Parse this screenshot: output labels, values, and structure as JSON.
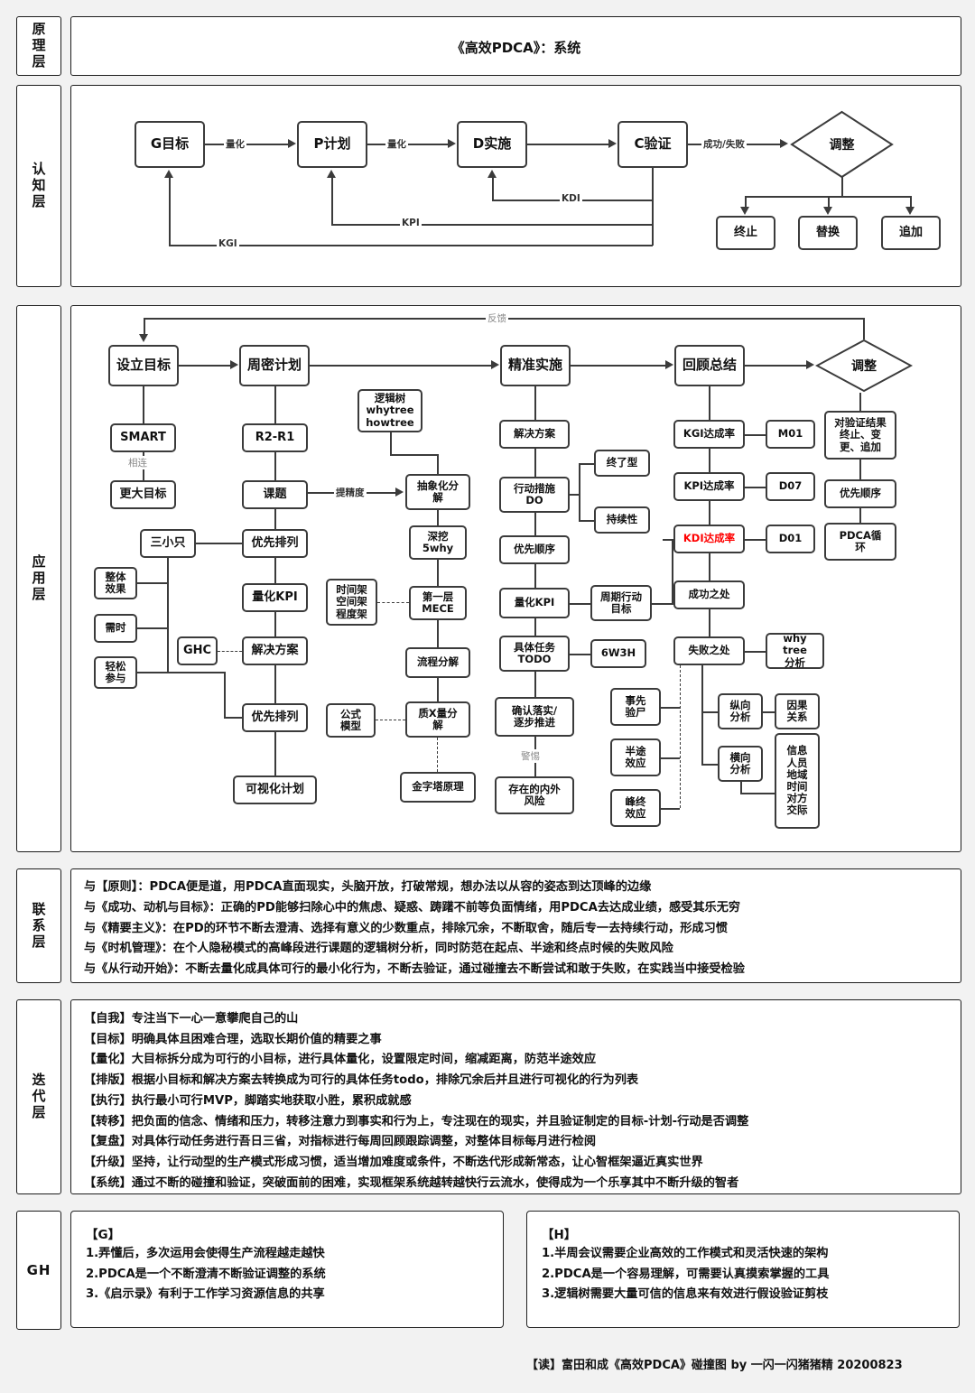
{
  "layers": {
    "principle": "原理层",
    "cognition": "认知层",
    "application": "应用层",
    "connection": "联系层",
    "iteration": "迭代层",
    "gh": "GH"
  },
  "title": "《高效PDCA》：系统",
  "cognition": {
    "nodes": {
      "g": "G目标",
      "p": "P计划",
      "d": "D实施",
      "c": "C验证",
      "adjust": "调整",
      "stop": "终止",
      "replace": "替换",
      "append": "追加"
    },
    "edges": {
      "quant1": "量化",
      "quant2": "量化",
      "succfail": "成功/失败",
      "kdi": "KDI",
      "kpi": "KPI",
      "kgi": "KGI"
    }
  },
  "application": {
    "feedback": "反馈",
    "main": {
      "goal": "设立目标",
      "plan": "周密计划",
      "do": "精准实施",
      "review": "回顾总结",
      "adjust": "调整"
    },
    "goal_col": {
      "smart": "SMART",
      "link_label": "相连",
      "bigger": "更大目标"
    },
    "plan_col": {
      "r2r1": "R2-R1",
      "topic": "课题",
      "prior1": "优先排列",
      "kpi": "量化KPI",
      "solution": "解决方案",
      "prior2": "优先排列",
      "visual": "可视化计划",
      "ghc": "GHC",
      "three": "三小只",
      "whole": "整体\n效果",
      "need": "需时",
      "easy": "轻松\n参与",
      "precision_label": "提精度"
    },
    "decomp_col": {
      "logic_tree": "逻辑树\nwhytree\nhowtree",
      "abstract": "抽象化分\n解",
      "fivewhy": "深挖\n5why",
      "mece": "第一层\nMECE",
      "frames": "时间架\n空间架\n程度架",
      "process": "流程分解",
      "formula": "公式\n模型",
      "qxq": "质X量分\n解",
      "pyramid": "金字塔原理"
    },
    "do_col": {
      "solution": "解决方案",
      "action": "行动措施\nDO",
      "ending": "终了型",
      "lasting": "持续性",
      "priority": "优先顺序",
      "kpi": "量化KPI",
      "cycle_goal": "周期行动\n目标",
      "todo": "具体任务\nTODO",
      "w6h3": "6W3H",
      "confirm": "确认落实/\n逐步推进",
      "alert_label": "警惕",
      "risk": "存在的内外\n风险",
      "pre_autopsy": "事先\n验尸",
      "midway": "半途\n效应",
      "peakend": "峰终\n效应"
    },
    "review_col": {
      "kgi": "KGI达成率",
      "kgi_code": "M01",
      "kpi": "KPI达成率",
      "kpi_code": "D07",
      "kdi": "KDI达成率",
      "kdi_code": "D01",
      "success": "成功之处",
      "failure": "失败之处",
      "whytree": "why tree\n分析",
      "vertical": "纵向\n分析",
      "causal": "因果\n关系",
      "horizontal": "横向\n分析",
      "dims": "信息\n人员\n地域\n时间\n对方\n交际"
    },
    "adjust_col": {
      "result": "对验证结果\n终止、变\n更、追加",
      "priority": "优先顺序",
      "pdca": "PDCA循\n环"
    }
  },
  "connection_lines": [
    "与【原则】：PDCA便是道，用PDCA直面现实，头脑开放，打破常规，想办法以从容的姿态到达顶峰的边缘",
    "与《成功、动机与目标》：正确的PD能够扫除心中的焦虑、疑惑、踌躇不前等负面情绪，用PDCA去达成业绩，感受其乐无穷",
    "与《精要主义》：在PD的环节不断去澄清、选择有意义的少数重点，排除冗余，不断取舍，随后专一去持续行动，形成习惯",
    "与《时机管理》：在个人隐秘模式的高峰段进行课题的逻辑树分析，同时防范在起点、半途和终点时候的失败风险",
    "与《从行动开始》：不断去量化成具体可行的最小化行为，不断去验证，通过碰撞去不断尝试和敢于失败，在实践当中接受检验"
  ],
  "iteration_lines": [
    "【自我】专注当下一心一意攀爬自己的山",
    "【目标】明确具体且困难合理，选取长期价值的精要之事",
    "【量化】大目标拆分成为可行的小目标，进行具体量化，设置限定时间，缩减距离，防范半途效应",
    "【排版】根据小目标和解决方案去转换成为可行的具体任务todo，排除冗余后并且进行可视化的行为列表",
    "【执行】执行最小可行MVP，脚踏实地获取小胜，累积成就感",
    "【转移】把负面的信念、情绪和压力，转移注意力到事实和行为上，专注现在的现实，并且验证制定的目标-计划-行动是否调整",
    "【复盘】对具体行动任务进行吾日三省，对指标进行每周回顾跟踪调整，对整体目标每月进行检阅",
    "【升级】坚持，让行动型的生产模式形成习惯，适当增加难度或条件，不断迭代形成新常态，让心智框架逼近真实世界",
    "【系统】通过不断的碰撞和验证，突破面前的困难，实现框架系统越转越快行云流水，使得成为一个乐享其中不断升级的智者"
  ],
  "gh": {
    "g": {
      "title": "【G】",
      "lines": [
        "1.弄懂后，多次运用会使得生产流程越走越快",
        "2.PDCA是一个不断澄清不断验证调整的系统",
        "3.《启示录》有利于工作学习资源信息的共享"
      ]
    },
    "h": {
      "title": "【H】",
      "lines": [
        "1.半周会议需要企业高效的工作模式和灵活快速的架构",
        "2.PDCA是一个容易理解，可需要认真摸索掌握的工具",
        "3.逻辑树需要大量可信的信息来有效进行假设验证剪枝"
      ]
    }
  },
  "credit": "【读】富田和成《高效PDCA》碰撞图 by 一闪一闪猪猪精 20200823",
  "colors": {
    "accent_red": "#ff0000",
    "line": "#3b3b3b",
    "border": "#1c1c1c"
  }
}
